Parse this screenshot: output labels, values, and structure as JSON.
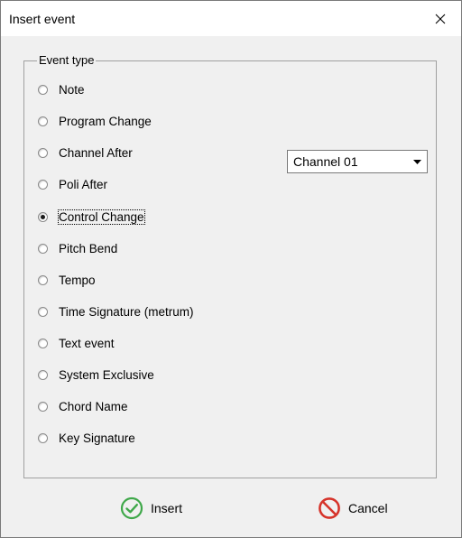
{
  "window": {
    "title": "Insert event"
  },
  "group": {
    "legend": "Event type",
    "options": [
      {
        "label": "Note",
        "checked": false
      },
      {
        "label": "Program Change",
        "checked": false
      },
      {
        "label": "Channel After",
        "checked": false
      },
      {
        "label": "Poli After",
        "checked": false
      },
      {
        "label": "Control Change",
        "checked": true
      },
      {
        "label": "Pitch Bend",
        "checked": false
      },
      {
        "label": "Tempo",
        "checked": false
      },
      {
        "label": "Time Signature (metrum)",
        "checked": false
      },
      {
        "label": "Text event",
        "checked": false
      },
      {
        "label": "System Exclusive",
        "checked": false
      },
      {
        "label": "Chord Name",
        "checked": false
      },
      {
        "label": "Key Signature",
        "checked": false
      }
    ]
  },
  "channel_select": {
    "value": "Channel 01"
  },
  "buttons": {
    "insert_label": "Insert",
    "cancel_label": "Cancel"
  },
  "colors": {
    "insert_icon": "#3fa84a",
    "cancel_icon": "#d6332a"
  },
  "icons": {
    "close": "close-icon",
    "dropdown": "chevron-down-icon",
    "insert": "check-circle-icon",
    "cancel": "no-entry-icon"
  }
}
